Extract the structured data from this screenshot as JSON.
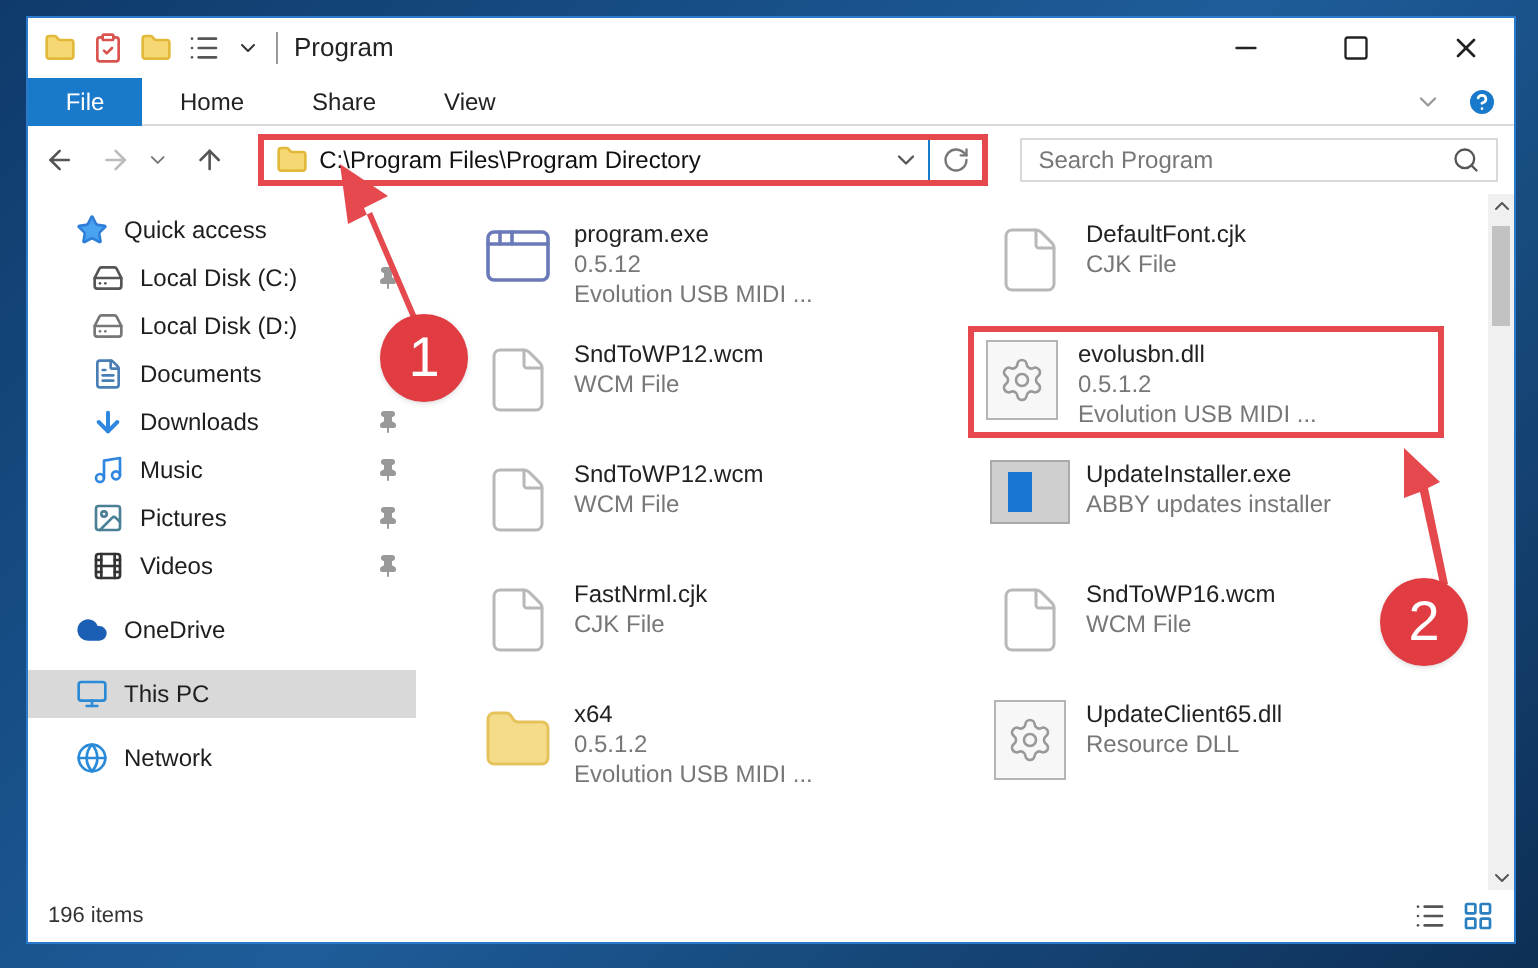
{
  "window": {
    "title": "Program"
  },
  "ribbon_tabs": [
    {
      "label": "File",
      "selected": true
    },
    {
      "label": "Home",
      "selected": false
    },
    {
      "label": "Share",
      "selected": false
    },
    {
      "label": "View",
      "selected": false
    }
  ],
  "address": {
    "path": "C:\\Program Files\\Program Directory",
    "highlighted": true
  },
  "search": {
    "placeholder": "Search Program"
  },
  "sidebar": {
    "items": [
      {
        "label": "Quick access",
        "kind": "star",
        "selected": false,
        "children": [
          {
            "label": "Local Disk (C:)",
            "kind": "disk-c",
            "pinned": true,
            "selected": false
          },
          {
            "label": "Local Disk (D:)",
            "kind": "disk",
            "pinned": false,
            "selected": false
          },
          {
            "label": "Documents",
            "kind": "documents",
            "pinned": false,
            "selected": false
          },
          {
            "label": "Downloads",
            "kind": "downloads",
            "pinned": true,
            "selected": false
          },
          {
            "label": "Music",
            "kind": "music",
            "pinned": true,
            "selected": false
          },
          {
            "label": "Pictures",
            "kind": "pictures",
            "pinned": true,
            "selected": false
          },
          {
            "label": "Videos",
            "kind": "videos",
            "pinned": true,
            "selected": false
          }
        ]
      },
      {
        "label": "OneDrive",
        "kind": "cloud",
        "selected": false
      },
      {
        "label": "This PC",
        "kind": "pc",
        "selected": true
      },
      {
        "label": "Network",
        "kind": "network",
        "selected": false
      }
    ]
  },
  "files": [
    {
      "name": "program.exe",
      "details": [
        "0.5.12",
        "Evolution USB MIDI ..."
      ],
      "kind": "exe",
      "highlighted": false
    },
    {
      "name": "DefaultFont.cjk",
      "details": [
        "CJK File"
      ],
      "kind": "file",
      "highlighted": false
    },
    {
      "name": "SndToWP12.wcm",
      "details": [
        "WCM File"
      ],
      "kind": "file",
      "highlighted": false
    },
    {
      "name": "evolusbn.dll",
      "details": [
        "0.5.1.2",
        "Evolution USB MIDI ..."
      ],
      "kind": "dll",
      "highlighted": true
    },
    {
      "name": "SndToWP12.wcm",
      "details": [
        "WCM File"
      ],
      "kind": "file",
      "highlighted": false
    },
    {
      "name": "UpdateInstaller.exe",
      "details": [
        "ABBY updates installer"
      ],
      "kind": "installer",
      "highlighted": false
    },
    {
      "name": "FastNrml.cjk",
      "details": [
        "CJK File"
      ],
      "kind": "file",
      "highlighted": false
    },
    {
      "name": "SndToWP16.wcm",
      "details": [
        "WCM File"
      ],
      "kind": "file",
      "highlighted": false
    },
    {
      "name": "x64",
      "details": [
        "0.5.1.2",
        "Evolution USB MIDI ..."
      ],
      "kind": "folder",
      "highlighted": false
    },
    {
      "name": "UpdateClient65.dll",
      "details": [
        "Resource DLL"
      ],
      "kind": "dll",
      "highlighted": false
    }
  ],
  "status_bar": {
    "count": "196 items"
  },
  "callouts": [
    {
      "label": "1"
    },
    {
      "label": "2"
    }
  ]
}
